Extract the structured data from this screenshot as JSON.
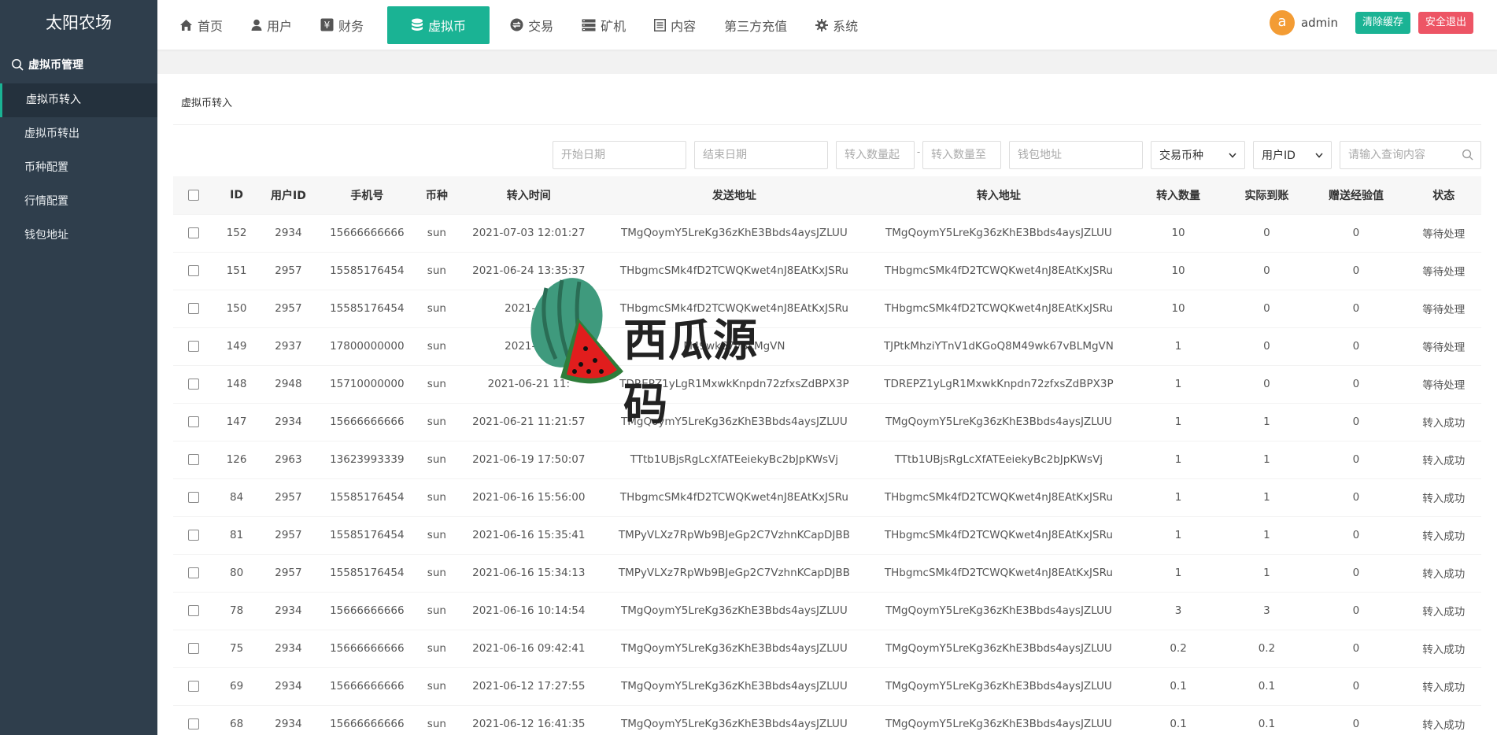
{
  "brand": "太阳农场",
  "sidebar": {
    "section_label": "虚拟币管理",
    "items": [
      {
        "label": "虚拟币转入",
        "active": true
      },
      {
        "label": "虚拟币转出"
      },
      {
        "label": "币种配置"
      },
      {
        "label": "行情配置"
      },
      {
        "label": "钱包地址"
      }
    ]
  },
  "nav": [
    {
      "label": "首页",
      "icon": "home-icon"
    },
    {
      "label": "用户",
      "icon": "user-icon"
    },
    {
      "label": "财务",
      "icon": "yen-icon"
    },
    {
      "label": "虚拟币",
      "icon": "database-icon",
      "active": true
    },
    {
      "label": "交易",
      "icon": "exchange-icon"
    },
    {
      "label": "矿机",
      "icon": "server-icon"
    },
    {
      "label": "内容",
      "icon": "list-icon"
    },
    {
      "label": "第三方充值",
      "icon": ""
    },
    {
      "label": "系统",
      "icon": "gear-icon"
    }
  ],
  "user": {
    "avatar": "a",
    "name": "admin"
  },
  "buttons": {
    "clear_cache": "清除缓存",
    "logout": "安全退出"
  },
  "panel": {
    "title": "虚拟币转入"
  },
  "filters": {
    "start_date": "开始日期",
    "end_date": "结束日期",
    "amount_from": "转入数量起",
    "amount_sep": "-",
    "amount_to": "转入数量至",
    "wallet": "钱包地址",
    "coin_select": "交易币种",
    "field_select": "用户ID",
    "query": "请输入查询内容"
  },
  "table": {
    "headers": [
      "ID",
      "用户ID",
      "手机号",
      "币种",
      "转入时间",
      "发送地址",
      "转入地址",
      "转入数量",
      "实际到账",
      "赠送经验值",
      "状态"
    ],
    "rows": [
      [
        "152",
        "2934",
        "15666666666",
        "sun",
        "2021-07-03 12:01:27",
        "TMgQoymY5LreKg36zKhE3Bbds4aysJZLUU",
        "TMgQoymY5LreKg36zKhE3Bbds4aysJZLUU",
        "10",
        "0",
        "0",
        "等待处理"
      ],
      [
        "151",
        "2957",
        "15585176454",
        "sun",
        "2021-06-24 13:35:37",
        "THbgmcSMk4fD2TCWQKwet4nJ8EAtKxJSRu",
        "THbgmcSMk4fD2TCWQKwet4nJ8EAtKxJSRu",
        "10",
        "0",
        "0",
        "等待处理"
      ],
      [
        "150",
        "2957",
        "15585176454",
        "sun",
        "2021-06-",
        "THbgmcSMk4fD2TCWQKwet4nJ8EAtKxJSRu",
        "THbgmcSMk4fD2TCWQKwet4nJ8EAtKxJSRu",
        "10",
        "0",
        "0",
        "等待处理"
      ],
      [
        "149",
        "2937",
        "17800000000",
        "sun",
        "2021-06-",
        "M49wk67vBLMgVN",
        "TJPtkMhziYTnV1dKGoQ8M49wk67vBLMgVN",
        "1",
        "0",
        "0",
        "等待处理"
      ],
      [
        "148",
        "2948",
        "15710000000",
        "sun",
        "2021-06-21 11:",
        "TDREPZ1yLgR1MxwkKnpdn72zfxsZdBPX3P",
        "TDREPZ1yLgR1MxwkKnpdn72zfxsZdBPX3P",
        "1",
        "0",
        "0",
        "等待处理"
      ],
      [
        "147",
        "2934",
        "15666666666",
        "sun",
        "2021-06-21 11:21:57",
        "TMgQoymY5LreKg36zKhE3Bbds4aysJZLUU",
        "TMgQoymY5LreKg36zKhE3Bbds4aysJZLUU",
        "1",
        "1",
        "0",
        "转入成功"
      ],
      [
        "126",
        "2963",
        "13623993339",
        "sun",
        "2021-06-19 17:50:07",
        "TTtb1UBjsRgLcXfATEeiekyBc2bJpKWsVj",
        "TTtb1UBjsRgLcXfATEeiekyBc2bJpKWsVj",
        "1",
        "1",
        "0",
        "转入成功"
      ],
      [
        "84",
        "2957",
        "15585176454",
        "sun",
        "2021-06-16 15:56:00",
        "THbgmcSMk4fD2TCWQKwet4nJ8EAtKxJSRu",
        "THbgmcSMk4fD2TCWQKwet4nJ8EAtKxJSRu",
        "1",
        "1",
        "0",
        "转入成功"
      ],
      [
        "81",
        "2957",
        "15585176454",
        "sun",
        "2021-06-16 15:35:41",
        "TMPyVLXz7RpWb9BJeGp2C7VzhnKCapDJBB",
        "THbgmcSMk4fD2TCWQKwet4nJ8EAtKxJSRu",
        "1",
        "1",
        "0",
        "转入成功"
      ],
      [
        "80",
        "2957",
        "15585176454",
        "sun",
        "2021-06-16 15:34:13",
        "TMPyVLXz7RpWb9BJeGp2C7VzhnKCapDJBB",
        "THbgmcSMk4fD2TCWQKwet4nJ8EAtKxJSRu",
        "1",
        "1",
        "0",
        "转入成功"
      ],
      [
        "78",
        "2934",
        "15666666666",
        "sun",
        "2021-06-16 10:14:54",
        "TMgQoymY5LreKg36zKhE3Bbds4aysJZLUU",
        "TMgQoymY5LreKg36zKhE3Bbds4aysJZLUU",
        "3",
        "3",
        "0",
        "转入成功"
      ],
      [
        "75",
        "2934",
        "15666666666",
        "sun",
        "2021-06-16 09:42:41",
        "TMgQoymY5LreKg36zKhE3Bbds4aysJZLUU",
        "TMgQoymY5LreKg36zKhE3Bbds4aysJZLUU",
        "0.2",
        "0.2",
        "0",
        "转入成功"
      ],
      [
        "69",
        "2934",
        "15666666666",
        "sun",
        "2021-06-12 17:27:55",
        "TMgQoymY5LreKg36zKhE3Bbds4aysJZLUU",
        "TMgQoymY5LreKg36zKhE3Bbds4aysJZLUU",
        "0.1",
        "0.1",
        "0",
        "转入成功"
      ],
      [
        "68",
        "2934",
        "15666666666",
        "sun",
        "2021-06-12 16:41:35",
        "TMgQoymY5LreKg36zKhE3Bbds4aysJZLUU",
        "TMgQoymY5LreKg36zKhE3Bbds4aysJZLUU",
        "0.1",
        "0.1",
        "0",
        "转入成功"
      ]
    ]
  },
  "watermark": {
    "text": "西瓜源码"
  },
  "colors": {
    "accent": "#1ab394",
    "danger": "#ed5565",
    "sidebar": "#2f3e4c",
    "avatar": "#f39c34"
  }
}
